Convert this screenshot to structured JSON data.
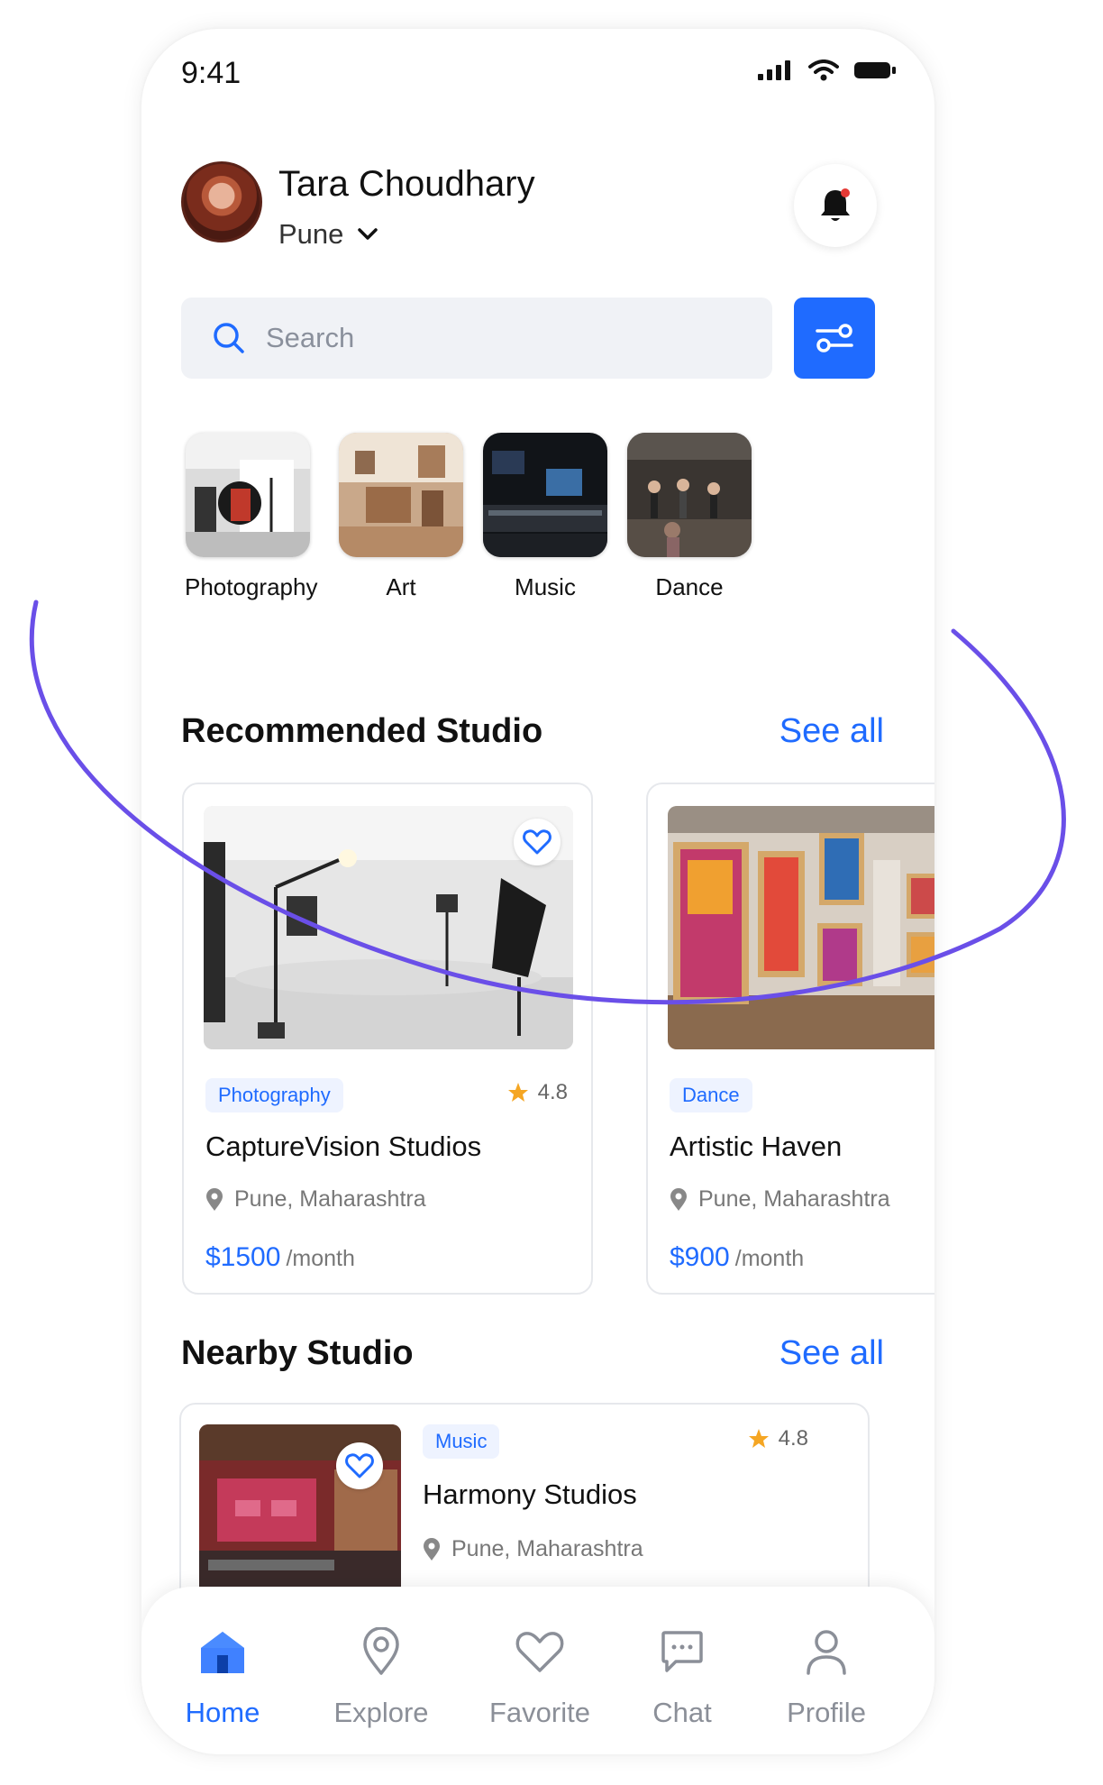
{
  "status": {
    "time": "9:41"
  },
  "user": {
    "name": "Tara Choudhary",
    "location": "Pune"
  },
  "search": {
    "placeholder": "Search"
  },
  "categories": [
    {
      "label": "Photography"
    },
    {
      "label": "Art"
    },
    {
      "label": "Music"
    },
    {
      "label": "Dance"
    }
  ],
  "recommended": {
    "title": "Recommended Studio",
    "see_all": "See all",
    "cards": [
      {
        "tag": "Photography",
        "rating": "4.8",
        "name": "CaptureVision Studios",
        "location": "Pune, Maharashtra",
        "price": "$1500",
        "per": "/month"
      },
      {
        "tag": "Dance",
        "name": "Artistic Haven",
        "location": "Pune, Maharashtra",
        "price": "$900",
        "per": "/month"
      }
    ]
  },
  "nearby": {
    "title": "Nearby Studio",
    "see_all": "See all",
    "cards": [
      {
        "tag": "Music",
        "rating": "4.8",
        "name": "Harmony Studios",
        "location": "Pune, Maharashtra"
      }
    ]
  },
  "nav": [
    {
      "label": "Home",
      "icon": "home-icon",
      "active": true
    },
    {
      "label": "Explore",
      "icon": "map-pin-icon"
    },
    {
      "label": "Favorite",
      "icon": "heart-icon"
    },
    {
      "label": "Chat",
      "icon": "chat-icon"
    },
    {
      "label": "Profile",
      "icon": "user-icon"
    }
  ],
  "colors": {
    "accent": "#1f6bff",
    "swoosh": "#6a4fe8",
    "star": "#f5a623"
  }
}
